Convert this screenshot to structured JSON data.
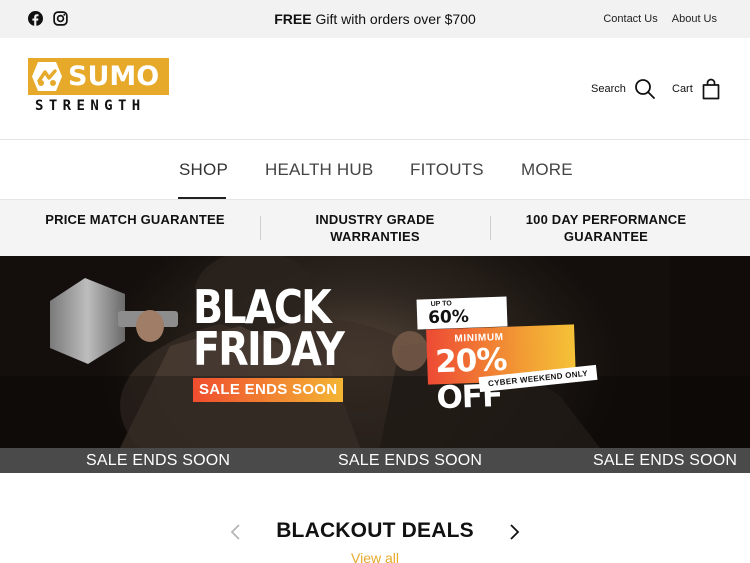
{
  "topbar": {
    "announcement_bold": "FREE",
    "announcement_rest": " Gift with orders over $700",
    "links": [
      "Contact Us",
      "About Us"
    ],
    "social_icons": [
      "facebook-icon",
      "instagram-icon"
    ]
  },
  "header": {
    "logo_word": "SUMO",
    "logo_sub": "STRENGTH",
    "search_label": "Search",
    "cart_label": "Cart",
    "brand_color": "#e6a92a"
  },
  "nav": {
    "items": [
      "SHOP",
      "HEALTH HUB",
      "FITOUTS",
      "MORE"
    ],
    "active": "SHOP"
  },
  "guarantees": {
    "items": [
      {
        "line1": "PRICE MATCH GUARANTEE",
        "line2": ""
      },
      {
        "line1": "INDUSTRY GRADE",
        "line2": "WARRANTIES"
      },
      {
        "line1": "100 DAY PERFORMANCE",
        "line2": "GUARANTEE"
      }
    ]
  },
  "hero": {
    "line1": "BLACK",
    "line2": "FRIDAY",
    "sale_tag": "SALE ENDS SOON",
    "upto_small": "UP TO",
    "upto_big": "60% OFF",
    "min_small": "MINIMUM",
    "min_big": "20% OFF",
    "cyber": "CYBER WEEKEND ONLY"
  },
  "marquee": {
    "items": [
      "SALE ENDS SOON",
      "SALE ENDS SOON",
      "SALE ENDS SOON"
    ]
  },
  "deals": {
    "title": "BLACKOUT DEALS",
    "view_all": "View all"
  }
}
